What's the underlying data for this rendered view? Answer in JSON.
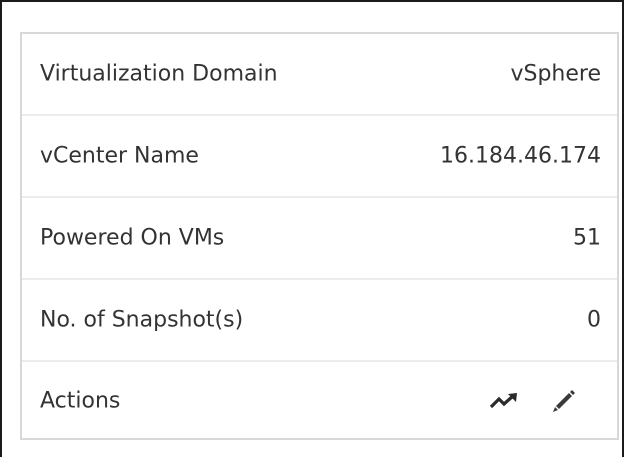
{
  "details": {
    "rows": [
      {
        "label": "Virtualization Domain",
        "value": "vSphere"
      },
      {
        "label": "vCenter Name",
        "value": "16.184.46.174"
      },
      {
        "label": "Powered On VMs",
        "value": "51"
      },
      {
        "label": "No. of Snapshot(s)",
        "value": "0"
      }
    ],
    "actions": {
      "label": "Actions",
      "items": [
        {
          "icon": "trend-icon"
        },
        {
          "icon": "pencil-icon"
        }
      ]
    }
  },
  "colors": {
    "text": "#333333",
    "panel_border": "#d8d8d8",
    "row_divider": "#ececec",
    "icon": "#2b2b2b"
  }
}
